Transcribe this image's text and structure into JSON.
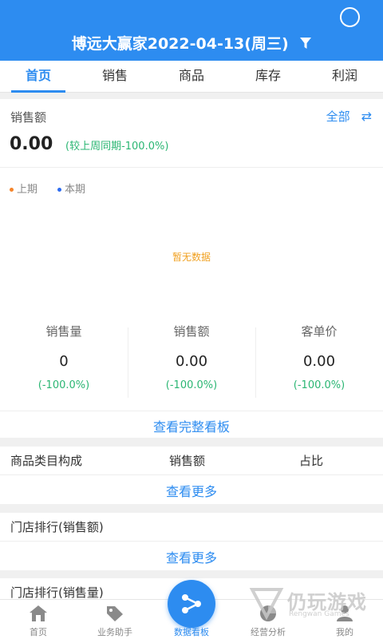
{
  "header": {
    "title": "博远大赢家2022-04-13(周三)"
  },
  "tabs": [
    {
      "label": "首页",
      "active": true
    },
    {
      "label": "销售",
      "active": false
    },
    {
      "label": "商品",
      "active": false
    },
    {
      "label": "库存",
      "active": false
    },
    {
      "label": "利润",
      "active": false
    }
  ],
  "sales": {
    "label": "销售额",
    "filter_label": "全部",
    "value": "0.00",
    "compare": "(较上周同期-100.0%)"
  },
  "chart": {
    "legend_prev": "上期",
    "legend_curr": "本期",
    "legend_prev_color": "#f5842a",
    "legend_curr_color": "#2d6cf0",
    "empty_text": "暂无数据"
  },
  "metrics": [
    {
      "label": "销售量",
      "value": "0",
      "change": "(-100.0%)"
    },
    {
      "label": "销售额",
      "value": "0.00",
      "change": "(-100.0%)"
    },
    {
      "label": "客单价",
      "value": "0.00",
      "change": "(-100.0%)"
    }
  ],
  "view_full_board": "查看完整看板",
  "category": {
    "col1": "商品类目构成",
    "col2": "销售额",
    "col3": "占比",
    "more": "查看更多"
  },
  "store_rank_amount": {
    "title": "门店排行(销售额)",
    "more": "查看更多"
  },
  "store_rank_qty": {
    "title": "门店排行(销售量)"
  },
  "bottom_nav": [
    {
      "label": "首页",
      "icon": "home-icon"
    },
    {
      "label": "业务助手",
      "icon": "tag-icon"
    },
    {
      "label": "数据看板",
      "icon": "share-icon",
      "active": true
    },
    {
      "label": "经营分析",
      "icon": "pie-icon"
    },
    {
      "label": "我的",
      "icon": "user-icon"
    }
  ],
  "watermark": {
    "text": "仍玩游戏",
    "sub": "Rengwan Games"
  },
  "colors": {
    "primary": "#2d8cf0",
    "positive": "#2bb673",
    "warning": "#f0a020"
  }
}
